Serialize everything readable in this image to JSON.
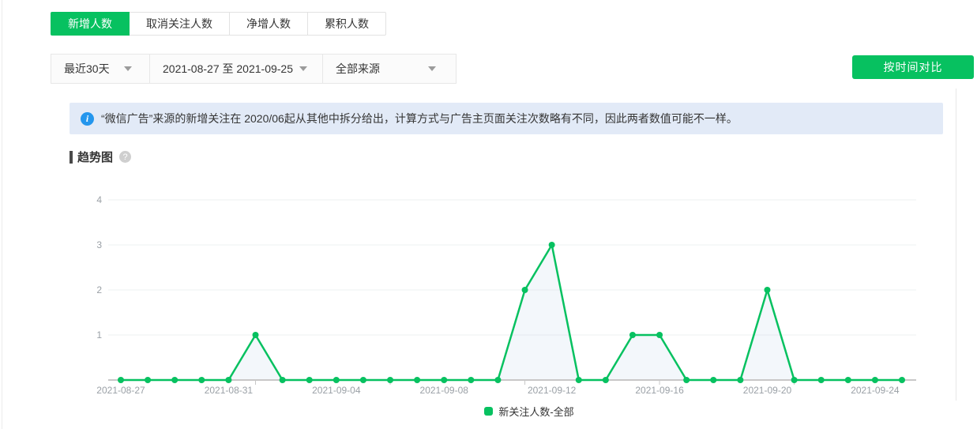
{
  "tabs": {
    "items": [
      {
        "label": "新增人数",
        "active": true
      },
      {
        "label": "取消关注人数",
        "active": false
      },
      {
        "label": "净增人数",
        "active": false
      },
      {
        "label": "累积人数",
        "active": false
      }
    ]
  },
  "filters": {
    "range_preset": "最近30天",
    "date_range": "2021-08-27 至 2021-09-25",
    "source": "全部来源",
    "compare_button_label": "按时间对比"
  },
  "banner": {
    "text": "“微信广告”来源的新增关注在 2020/06起从其他中拆分给出，计算方式与广告主页面关注次数略有不同，因此两者数值可能不一样。"
  },
  "section": {
    "title": "趋势图"
  },
  "legend": {
    "label": "新关注人数-全部"
  },
  "colors": {
    "accent_green": "#07C160",
    "info_blue": "#2496ED",
    "banner_bg": "#E2EAF7",
    "grid_line": "#eef0f2",
    "axis_line": "#c8c8c8",
    "axis_text": "#9aa0a6",
    "area_fill": "rgba(160,190,220,0.12)"
  },
  "chart_data": {
    "type": "line",
    "title": "趋势图",
    "series_name": "新关注人数-全部",
    "x": [
      "2021-08-27",
      "2021-08-28",
      "2021-08-29",
      "2021-08-30",
      "2021-08-31",
      "2021-09-01",
      "2021-09-02",
      "2021-09-03",
      "2021-09-04",
      "2021-09-05",
      "2021-09-06",
      "2021-09-07",
      "2021-09-08",
      "2021-09-09",
      "2021-09-10",
      "2021-09-11",
      "2021-09-12",
      "2021-09-13",
      "2021-09-14",
      "2021-09-15",
      "2021-09-16",
      "2021-09-17",
      "2021-09-18",
      "2021-09-19",
      "2021-09-20",
      "2021-09-21",
      "2021-09-22",
      "2021-09-23",
      "2021-09-24",
      "2021-09-25"
    ],
    "values": [
      0,
      0,
      0,
      0,
      0,
      1,
      0,
      0,
      0,
      0,
      0,
      0,
      0,
      0,
      0,
      2,
      3,
      0,
      0,
      1,
      1,
      0,
      0,
      0,
      2,
      0,
      0,
      0,
      0,
      0
    ],
    "ylim": [
      0,
      4
    ],
    "yticks": [
      1,
      2,
      3,
      4
    ],
    "x_label_every": 4,
    "x_tick_every": 5,
    "grid": true,
    "legend_position": "bottom",
    "line_color": "#07C160"
  }
}
